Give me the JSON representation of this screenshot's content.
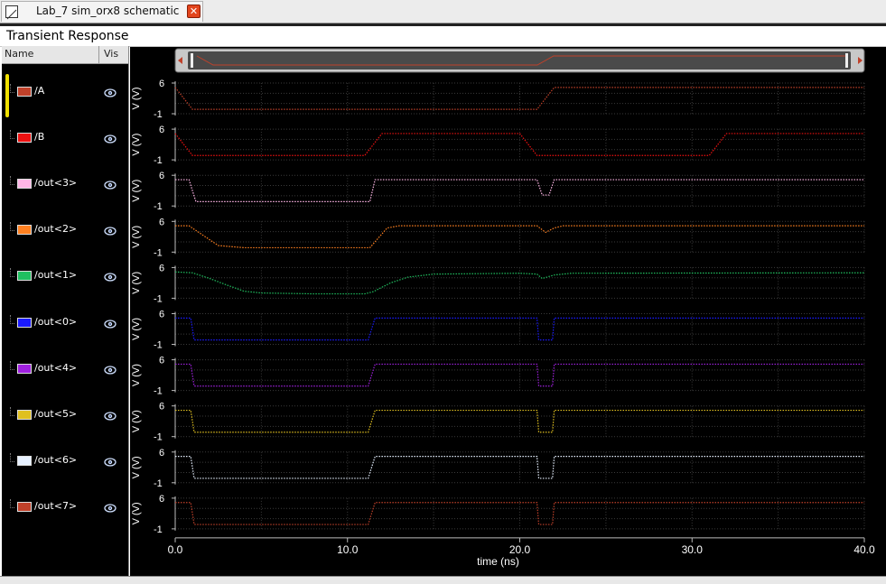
{
  "tab": {
    "title": "Lab_7 sim_orx8 schematic",
    "close_glyph": "✕"
  },
  "window": {
    "title": "Transient Response"
  },
  "panel": {
    "header_name": "Name",
    "header_vis": "Vis",
    "signals": [
      {
        "label": "/A",
        "color": "#c0412a",
        "name": "signal-A"
      },
      {
        "label": "/B",
        "color": "#ee1111",
        "name": "signal-B"
      },
      {
        "label": "/out<3>",
        "color": "#ffb6e6",
        "name": "signal-out3"
      },
      {
        "label": "/out<2>",
        "color": "#ff8020",
        "name": "signal-out2"
      },
      {
        "label": "/out<1>",
        "color": "#20c060",
        "name": "signal-out1"
      },
      {
        "label": "/out<0>",
        "color": "#1a1aff",
        "name": "signal-out0"
      },
      {
        "label": "/out<4>",
        "color": "#a020e0",
        "name": "signal-out4"
      },
      {
        "label": "/out<5>",
        "color": "#e0c020",
        "name": "signal-out5"
      },
      {
        "label": "/out<6>",
        "color": "#e6f0ff",
        "name": "signal-out6"
      },
      {
        "label": "/out<7>",
        "color": "#c0412a",
        "name": "signal-out7"
      }
    ]
  },
  "chart_data": {
    "type": "line",
    "xlabel": "time (ns)",
    "ylabel": "V (V)",
    "xlim": [
      0,
      40
    ],
    "ylim": [
      -1,
      6
    ],
    "x_ticks": [
      "0.0",
      "10.0",
      "20.0",
      "30.0",
      "40.0"
    ],
    "y_ticks": [
      "6",
      "-1"
    ],
    "grid": true,
    "series": [
      {
        "name": "/A",
        "color": "#c0412a",
        "points": [
          [
            0,
            5
          ],
          [
            1.0,
            0
          ],
          [
            21.0,
            0
          ],
          [
            22.0,
            5
          ],
          [
            40,
            5
          ]
        ]
      },
      {
        "name": "/B",
        "color": "#ee1111",
        "points": [
          [
            0,
            5
          ],
          [
            1.0,
            0
          ],
          [
            11.0,
            0
          ],
          [
            12.0,
            5
          ],
          [
            20.0,
            5
          ],
          [
            21.0,
            0
          ],
          [
            31.0,
            0
          ],
          [
            32.0,
            5
          ],
          [
            40,
            5
          ]
        ]
      },
      {
        "name": "/out<3>",
        "color": "#ffb6e6",
        "points": [
          [
            0,
            5
          ],
          [
            0.8,
            5
          ],
          [
            1.2,
            0
          ],
          [
            11.3,
            0
          ],
          [
            11.6,
            5
          ],
          [
            21.0,
            5
          ],
          [
            21.3,
            1.5
          ],
          [
            21.7,
            1.5
          ],
          [
            22.0,
            5
          ],
          [
            40,
            5
          ]
        ]
      },
      {
        "name": "/out<2>",
        "color": "#ff8020",
        "points": [
          [
            0,
            5
          ],
          [
            0.8,
            5
          ],
          [
            2.5,
            0.5
          ],
          [
            4,
            0
          ],
          [
            11.3,
            0
          ],
          [
            12.3,
            4.5
          ],
          [
            13,
            5
          ],
          [
            21.0,
            5
          ],
          [
            21.5,
            3.5
          ],
          [
            22.0,
            4.5
          ],
          [
            22.5,
            5
          ],
          [
            40,
            5
          ]
        ]
      },
      {
        "name": "/out<1>",
        "color": "#20c060",
        "points": [
          [
            0,
            5
          ],
          [
            1,
            4.8
          ],
          [
            2,
            3.5
          ],
          [
            3,
            2
          ],
          [
            4,
            0.6
          ],
          [
            5,
            0.2
          ],
          [
            8,
            0
          ],
          [
            11,
            0
          ],
          [
            11.5,
            0.5
          ],
          [
            12.5,
            2.5
          ],
          [
            13.5,
            3.8
          ],
          [
            15,
            4.5
          ],
          [
            20,
            4.7
          ],
          [
            21.0,
            4.5
          ],
          [
            21.3,
            3.5
          ],
          [
            22.0,
            4.3
          ],
          [
            23,
            4.7
          ],
          [
            40,
            4.8
          ]
        ]
      },
      {
        "name": "/out<0>",
        "color": "#1a1aff",
        "points": [
          [
            0,
            5
          ],
          [
            0.9,
            5
          ],
          [
            1.1,
            0
          ],
          [
            11.2,
            0
          ],
          [
            11.6,
            5
          ],
          [
            21.0,
            5
          ],
          [
            21.1,
            0
          ],
          [
            21.9,
            0
          ],
          [
            22.0,
            5
          ],
          [
            40,
            5
          ]
        ]
      },
      {
        "name": "/out<4>",
        "color": "#a020e0",
        "points": [
          [
            0,
            5
          ],
          [
            0.9,
            5
          ],
          [
            1.1,
            0
          ],
          [
            11.2,
            0
          ],
          [
            11.6,
            5
          ],
          [
            21.0,
            5
          ],
          [
            21.1,
            0
          ],
          [
            21.9,
            0
          ],
          [
            22.0,
            5
          ],
          [
            40,
            5
          ]
        ]
      },
      {
        "name": "/out<5>",
        "color": "#e0c020",
        "points": [
          [
            0,
            5
          ],
          [
            0.9,
            5
          ],
          [
            1.1,
            0
          ],
          [
            11.2,
            0
          ],
          [
            11.6,
            5
          ],
          [
            21.0,
            5
          ],
          [
            21.1,
            0
          ],
          [
            21.9,
            0
          ],
          [
            22.0,
            5
          ],
          [
            40,
            5
          ]
        ]
      },
      {
        "name": "/out<6>",
        "color": "#e6f0ff",
        "points": [
          [
            0,
            5
          ],
          [
            0.9,
            5
          ],
          [
            1.1,
            0
          ],
          [
            11.2,
            0
          ],
          [
            11.6,
            5
          ],
          [
            21.0,
            5
          ],
          [
            21.1,
            0
          ],
          [
            21.9,
            0
          ],
          [
            22.0,
            5
          ],
          [
            40,
            5
          ]
        ]
      },
      {
        "name": "/out<7>",
        "color": "#c0412a",
        "points": [
          [
            0,
            5
          ],
          [
            0.9,
            5
          ],
          [
            1.1,
            0
          ],
          [
            11.2,
            0
          ],
          [
            11.6,
            5
          ],
          [
            21.0,
            5
          ],
          [
            21.1,
            0
          ],
          [
            21.9,
            0
          ],
          [
            22.0,
            5
          ],
          [
            40,
            5
          ]
        ]
      }
    ],
    "overview": {
      "series": "/A"
    }
  }
}
